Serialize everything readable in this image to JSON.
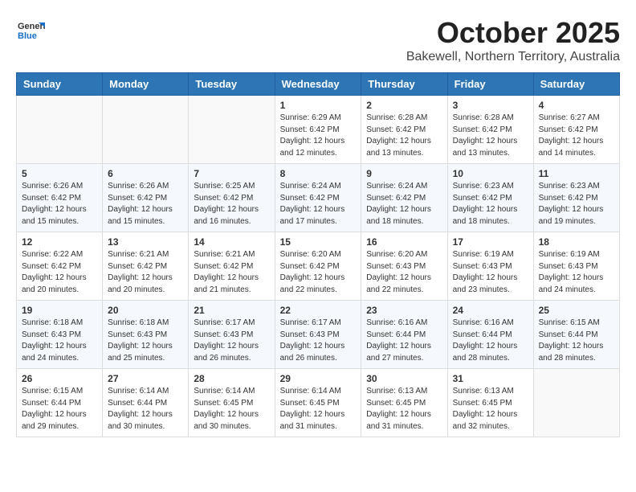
{
  "header": {
    "logo_general": "General",
    "logo_blue": "Blue",
    "month": "October 2025",
    "location": "Bakewell, Northern Territory, Australia"
  },
  "weekdays": [
    "Sunday",
    "Monday",
    "Tuesday",
    "Wednesday",
    "Thursday",
    "Friday",
    "Saturday"
  ],
  "weeks": [
    [
      {
        "day": "",
        "info": ""
      },
      {
        "day": "",
        "info": ""
      },
      {
        "day": "",
        "info": ""
      },
      {
        "day": "1",
        "info": "Sunrise: 6:29 AM\nSunset: 6:42 PM\nDaylight: 12 hours\nand 12 minutes."
      },
      {
        "day": "2",
        "info": "Sunrise: 6:28 AM\nSunset: 6:42 PM\nDaylight: 12 hours\nand 13 minutes."
      },
      {
        "day": "3",
        "info": "Sunrise: 6:28 AM\nSunset: 6:42 PM\nDaylight: 12 hours\nand 13 minutes."
      },
      {
        "day": "4",
        "info": "Sunrise: 6:27 AM\nSunset: 6:42 PM\nDaylight: 12 hours\nand 14 minutes."
      }
    ],
    [
      {
        "day": "5",
        "info": "Sunrise: 6:26 AM\nSunset: 6:42 PM\nDaylight: 12 hours\nand 15 minutes."
      },
      {
        "day": "6",
        "info": "Sunrise: 6:26 AM\nSunset: 6:42 PM\nDaylight: 12 hours\nand 15 minutes."
      },
      {
        "day": "7",
        "info": "Sunrise: 6:25 AM\nSunset: 6:42 PM\nDaylight: 12 hours\nand 16 minutes."
      },
      {
        "day": "8",
        "info": "Sunrise: 6:24 AM\nSunset: 6:42 PM\nDaylight: 12 hours\nand 17 minutes."
      },
      {
        "day": "9",
        "info": "Sunrise: 6:24 AM\nSunset: 6:42 PM\nDaylight: 12 hours\nand 18 minutes."
      },
      {
        "day": "10",
        "info": "Sunrise: 6:23 AM\nSunset: 6:42 PM\nDaylight: 12 hours\nand 18 minutes."
      },
      {
        "day": "11",
        "info": "Sunrise: 6:23 AM\nSunset: 6:42 PM\nDaylight: 12 hours\nand 19 minutes."
      }
    ],
    [
      {
        "day": "12",
        "info": "Sunrise: 6:22 AM\nSunset: 6:42 PM\nDaylight: 12 hours\nand 20 minutes."
      },
      {
        "day": "13",
        "info": "Sunrise: 6:21 AM\nSunset: 6:42 PM\nDaylight: 12 hours\nand 20 minutes."
      },
      {
        "day": "14",
        "info": "Sunrise: 6:21 AM\nSunset: 6:42 PM\nDaylight: 12 hours\nand 21 minutes."
      },
      {
        "day": "15",
        "info": "Sunrise: 6:20 AM\nSunset: 6:42 PM\nDaylight: 12 hours\nand 22 minutes."
      },
      {
        "day": "16",
        "info": "Sunrise: 6:20 AM\nSunset: 6:43 PM\nDaylight: 12 hours\nand 22 minutes."
      },
      {
        "day": "17",
        "info": "Sunrise: 6:19 AM\nSunset: 6:43 PM\nDaylight: 12 hours\nand 23 minutes."
      },
      {
        "day": "18",
        "info": "Sunrise: 6:19 AM\nSunset: 6:43 PM\nDaylight: 12 hours\nand 24 minutes."
      }
    ],
    [
      {
        "day": "19",
        "info": "Sunrise: 6:18 AM\nSunset: 6:43 PM\nDaylight: 12 hours\nand 24 minutes."
      },
      {
        "day": "20",
        "info": "Sunrise: 6:18 AM\nSunset: 6:43 PM\nDaylight: 12 hours\nand 25 minutes."
      },
      {
        "day": "21",
        "info": "Sunrise: 6:17 AM\nSunset: 6:43 PM\nDaylight: 12 hours\nand 26 minutes."
      },
      {
        "day": "22",
        "info": "Sunrise: 6:17 AM\nSunset: 6:43 PM\nDaylight: 12 hours\nand 26 minutes."
      },
      {
        "day": "23",
        "info": "Sunrise: 6:16 AM\nSunset: 6:44 PM\nDaylight: 12 hours\nand 27 minutes."
      },
      {
        "day": "24",
        "info": "Sunrise: 6:16 AM\nSunset: 6:44 PM\nDaylight: 12 hours\nand 28 minutes."
      },
      {
        "day": "25",
        "info": "Sunrise: 6:15 AM\nSunset: 6:44 PM\nDaylight: 12 hours\nand 28 minutes."
      }
    ],
    [
      {
        "day": "26",
        "info": "Sunrise: 6:15 AM\nSunset: 6:44 PM\nDaylight: 12 hours\nand 29 minutes."
      },
      {
        "day": "27",
        "info": "Sunrise: 6:14 AM\nSunset: 6:44 PM\nDaylight: 12 hours\nand 30 minutes."
      },
      {
        "day": "28",
        "info": "Sunrise: 6:14 AM\nSunset: 6:45 PM\nDaylight: 12 hours\nand 30 minutes."
      },
      {
        "day": "29",
        "info": "Sunrise: 6:14 AM\nSunset: 6:45 PM\nDaylight: 12 hours\nand 31 minutes."
      },
      {
        "day": "30",
        "info": "Sunrise: 6:13 AM\nSunset: 6:45 PM\nDaylight: 12 hours\nand 31 minutes."
      },
      {
        "day": "31",
        "info": "Sunrise: 6:13 AM\nSunset: 6:45 PM\nDaylight: 12 hours\nand 32 minutes."
      },
      {
        "day": "",
        "info": ""
      }
    ]
  ]
}
